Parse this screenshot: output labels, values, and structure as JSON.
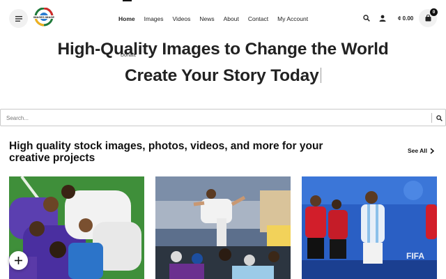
{
  "header": {
    "logo_icon": "images-image-logo",
    "nav": [
      {
        "label": "Home",
        "active": true
      },
      {
        "label": "Images",
        "active": false
      },
      {
        "label": "Videos",
        "active": false
      },
      {
        "label": "News",
        "active": false
      },
      {
        "label": "About",
        "active": false
      },
      {
        "label": "Contact",
        "active": false
      },
      {
        "label": "My Account",
        "active": false
      }
    ],
    "donate_label": "Donate",
    "cart_total": "¢ 0.00",
    "cart_count": "0",
    "icons": [
      "menu-icon",
      "search-icon",
      "user-icon",
      "cart-icon"
    ]
  },
  "hero": {
    "line1": "High-Quality Images to Change the World",
    "line2": "Create Your Story Today"
  },
  "search": {
    "placeholder": "Search..."
  },
  "section": {
    "title": "High quality stock images, photos, videos, and more for your creative projects",
    "see_all": "See All"
  },
  "cards": [
    {
      "name": "football-celebration-green-photo"
    },
    {
      "name": "player-lifted-by-crowd-photo"
    },
    {
      "name": "red-vs-white-blue-match-photo"
    }
  ],
  "colors": {
    "text": "#1b1b1b",
    "button_bg": "#f1f1f1",
    "accent": "#111111"
  }
}
